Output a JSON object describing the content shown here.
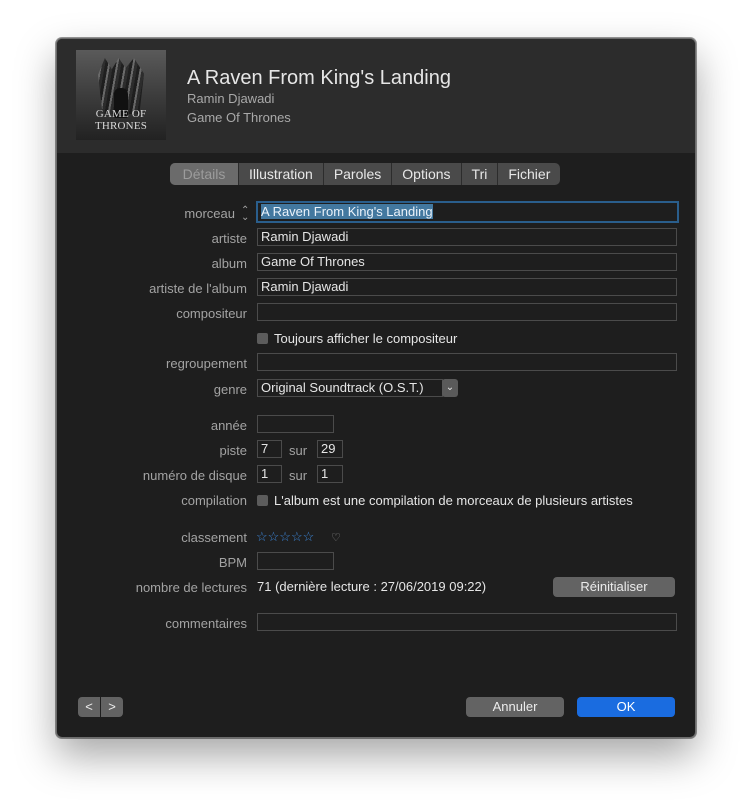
{
  "header": {
    "title": "A Raven From King's Landing",
    "artist": "Ramin Djawadi",
    "album": "Game Of Thrones",
    "cover_text": "GAME OF THRONES"
  },
  "tabs": [
    {
      "label": "Détails",
      "active": true
    },
    {
      "label": "Illustration",
      "active": false
    },
    {
      "label": "Paroles",
      "active": false
    },
    {
      "label": "Options",
      "active": false
    },
    {
      "label": "Tri",
      "active": false
    },
    {
      "label": "Fichier",
      "active": false
    }
  ],
  "fields": {
    "morceau": {
      "label": "morceau",
      "value": "A Raven From King's Landing"
    },
    "artiste": {
      "label": "artiste",
      "value": "Ramin Djawadi"
    },
    "album": {
      "label": "album",
      "value": "Game Of Thrones"
    },
    "artiste_album": {
      "label": "artiste de l'album",
      "value": "Ramin Djawadi"
    },
    "compositeur": {
      "label": "compositeur",
      "value": ""
    },
    "toujours_afficher": {
      "label": "Toujours afficher le compositeur",
      "checked": false
    },
    "regroupement": {
      "label": "regroupement",
      "value": ""
    },
    "genre": {
      "label": "genre",
      "value": "Original Soundtrack (O.S.T.)"
    },
    "annee": {
      "label": "année",
      "value": ""
    },
    "piste": {
      "label": "piste",
      "value": "7",
      "sur_label": "sur",
      "total": "29"
    },
    "disque": {
      "label": "numéro de disque",
      "value": "1",
      "sur_label": "sur",
      "total": "1"
    },
    "compilation": {
      "label": "compilation",
      "text": "L'album est une compilation de morceaux de plusieurs artistes",
      "checked": false
    },
    "classement": {
      "label": "classement",
      "stars": "☆☆☆☆☆",
      "rating": 0,
      "heart": "♡"
    },
    "bpm": {
      "label": "BPM",
      "value": ""
    },
    "lectures": {
      "label": "nombre de lectures",
      "value": "71 (dernière lecture : 27/06/2019 09:22)",
      "reset_label": "Réinitialiser"
    },
    "commentaires": {
      "label": "commentaires",
      "value": ""
    }
  },
  "footer": {
    "prev": "<",
    "next": ">",
    "cancel_label": "Annuler",
    "ok_label": "OK"
  },
  "colors": {
    "window_bg": "#1e1e1e",
    "header_bg": "#2c2c2c",
    "accent": "#1a6ce0",
    "star": "#3d86d8"
  }
}
